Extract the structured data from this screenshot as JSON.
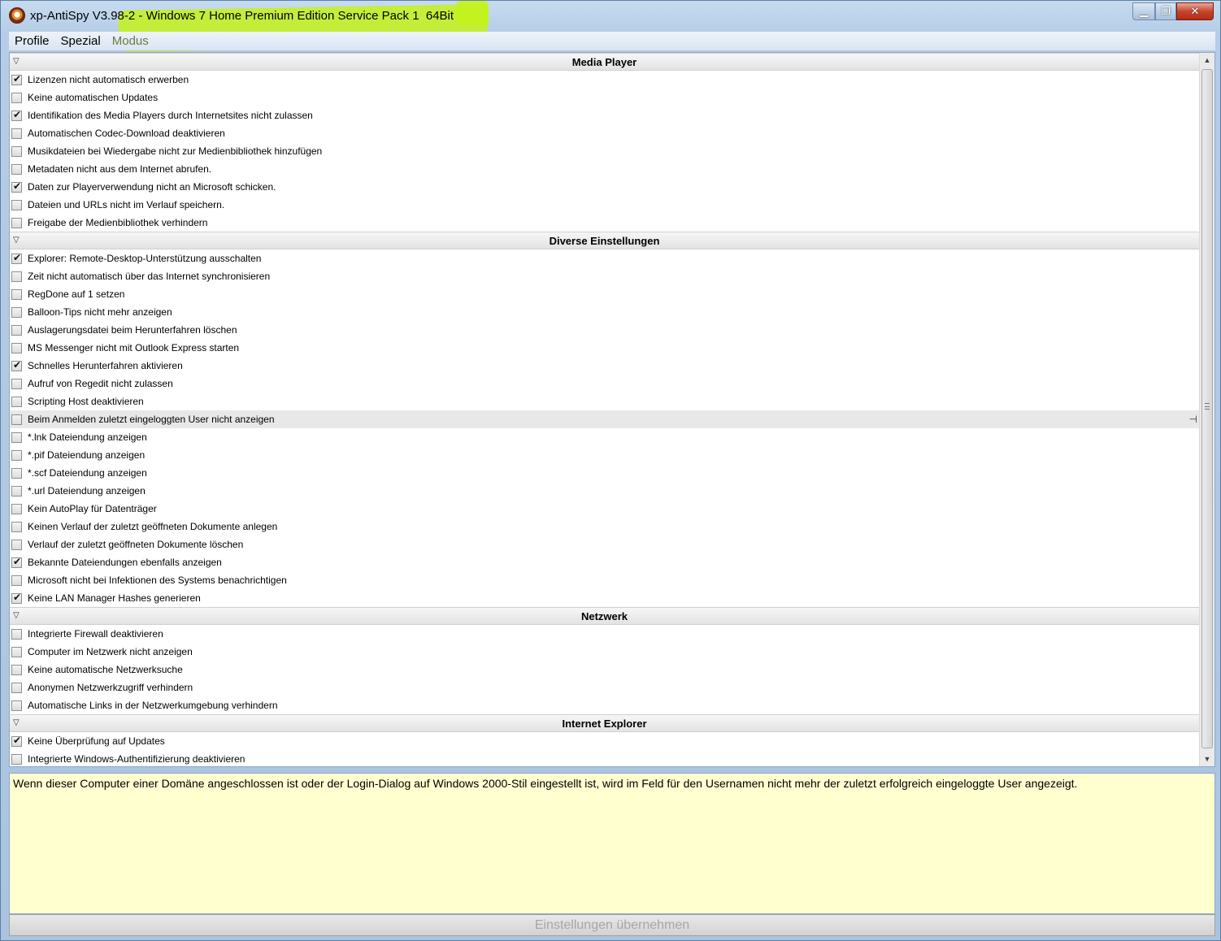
{
  "window": {
    "title_app": "xp-AntiSpy V3.98-2 - ",
    "title_os": "Windows 7 Home Premium Edition Service Pack 1  64Bit",
    "controls": {
      "minimize": "▁",
      "maximize": "❐",
      "close": "✕"
    }
  },
  "menu": [
    "Profile",
    "Spezial",
    "Modus"
  ],
  "groups": [
    {
      "title": "Media Player",
      "items": [
        {
          "label": "Lizenzen nicht automatisch erwerben",
          "checked": true
        },
        {
          "label": "Keine automatischen Updates",
          "checked": false
        },
        {
          "label": "Identifikation des Media Players durch Internetsites nicht zulassen",
          "checked": true
        },
        {
          "label": "Automatischen Codec-Download deaktivieren",
          "checked": false
        },
        {
          "label": "Musikdateien bei Wiedergabe nicht zur Medienbibliothek hinzufügen",
          "checked": false
        },
        {
          "label": "Metadaten nicht aus dem Internet abrufen.",
          "checked": false
        },
        {
          "label": "Daten zur Playerverwendung nicht an Microsoft schicken.",
          "checked": true
        },
        {
          "label": "Dateien und URLs nicht im Verlauf speichern.",
          "checked": false
        },
        {
          "label": "Freigabe der Medienbibliothek verhindern",
          "checked": false
        }
      ]
    },
    {
      "title": "Diverse Einstellungen",
      "items": [
        {
          "label": "Explorer: Remote-Desktop-Unterstützung ausschalten",
          "checked": true
        },
        {
          "label": "Zeit nicht automatisch über das Internet synchronisieren",
          "checked": false
        },
        {
          "label": "RegDone auf 1 setzen",
          "checked": false
        },
        {
          "label": "Balloon-Tips nicht mehr anzeigen",
          "checked": false
        },
        {
          "label": "Auslagerungsdatei beim Herunterfahren löschen",
          "checked": false
        },
        {
          "label": "MS Messenger nicht mit Outlook Express starten",
          "checked": false
        },
        {
          "label": "Schnelles Herunterfahren aktivieren",
          "checked": true
        },
        {
          "label": "Aufruf von Regedit nicht zulassen",
          "checked": false
        },
        {
          "label": "Scripting Host deaktivieren",
          "checked": false
        },
        {
          "label": "Beim Anmelden zuletzt eingeloggten User nicht anzeigen",
          "checked": false,
          "selected": true
        },
        {
          "label": "*.lnk Dateiendung anzeigen",
          "checked": false
        },
        {
          "label": "*.pif Dateiendung anzeigen",
          "checked": false
        },
        {
          "label": "*.scf Dateiendung anzeigen",
          "checked": false
        },
        {
          "label": "*.url Dateiendung anzeigen",
          "checked": false
        },
        {
          "label": "Kein AutoPlay für Datenträger",
          "checked": false
        },
        {
          "label": "Keinen Verlauf der zuletzt geöffneten Dokumente anlegen",
          "checked": false
        },
        {
          "label": "Verlauf der zuletzt geöffneten Dokumente löschen",
          "checked": false
        },
        {
          "label": "Bekannte Dateiendungen ebenfalls anzeigen",
          "checked": true
        },
        {
          "label": "Microsoft nicht bei Infektionen des Systems benachrichtigen",
          "checked": false
        },
        {
          "label": "Keine LAN Manager Hashes generieren",
          "checked": true
        }
      ]
    },
    {
      "title": "Netzwerk",
      "items": [
        {
          "label": "Integrierte Firewall deaktivieren",
          "checked": false
        },
        {
          "label": "Computer im Netzwerk nicht anzeigen",
          "checked": false
        },
        {
          "label": "Keine automatische Netzwerksuche",
          "checked": false
        },
        {
          "label": "Anonymen Netzwerkzugriff verhindern",
          "checked": false
        },
        {
          "label": "Automatische Links in der Netzwerkumgebung verhindern",
          "checked": false
        }
      ]
    },
    {
      "title": "Internet Explorer",
      "items": [
        {
          "label": "Keine Überprüfung auf Updates",
          "checked": true
        },
        {
          "label": "Integrierte Windows-Authentifizierung deaktivieren",
          "checked": false
        }
      ]
    }
  ],
  "description": "Wenn dieser Computer einer Domäne angeschlossen ist oder der Login-Dialog auf Windows 2000-Stil eingestellt ist, wird im Feld für den Usernamen nicht mehr der zuletzt erfolgreich eingeloggte User angezeigt.",
  "apply_button": "Einstellungen übernehmen",
  "colors": {
    "highlight_marker": "#c4f21a",
    "description_bg": "#ffffcf",
    "close_button": "#c7452d"
  },
  "icons": {
    "app": "antispy-app-icon",
    "group_toggle": "chevron-down-icon",
    "pin": "pin-icon"
  }
}
